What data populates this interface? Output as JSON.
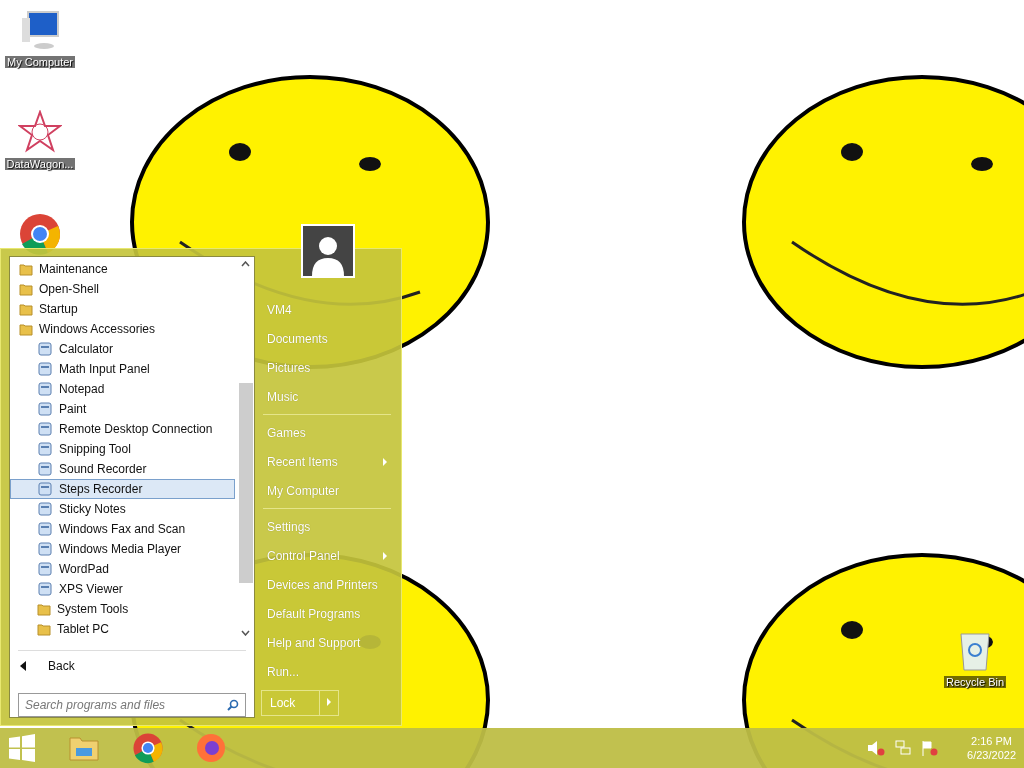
{
  "desktop_icons": [
    {
      "label": "My Computer",
      "kind": "computer"
    },
    {
      "label": "DataWagon...",
      "kind": "star"
    },
    {
      "kind": "chrome"
    }
  ],
  "recycle_bin": {
    "label": "Recycle Bin"
  },
  "start_menu": {
    "programs": [
      {
        "label": "Maintenance",
        "kind": "folder",
        "selected": false
      },
      {
        "label": "Open-Shell",
        "kind": "folder",
        "selected": false
      },
      {
        "label": "Startup",
        "kind": "folder",
        "selected": false
      },
      {
        "label": "Windows Accessories",
        "kind": "folder",
        "selected": false,
        "children": [
          {
            "label": "Calculator",
            "kind": "app",
            "selected": false
          },
          {
            "label": "Math Input Panel",
            "kind": "app",
            "selected": false
          },
          {
            "label": "Notepad",
            "kind": "app",
            "selected": false
          },
          {
            "label": "Paint",
            "kind": "app",
            "selected": false
          },
          {
            "label": "Remote Desktop Connection",
            "kind": "app",
            "selected": false
          },
          {
            "label": "Snipping Tool",
            "kind": "app",
            "selected": false
          },
          {
            "label": "Sound Recorder",
            "kind": "app",
            "selected": false
          },
          {
            "label": "Steps Recorder",
            "kind": "app",
            "selected": true
          },
          {
            "label": "Sticky Notes",
            "kind": "app",
            "selected": false
          },
          {
            "label": "Windows Fax and Scan",
            "kind": "app",
            "selected": false
          },
          {
            "label": "Windows Media Player",
            "kind": "app",
            "selected": false
          },
          {
            "label": "WordPad",
            "kind": "app",
            "selected": false
          },
          {
            "label": "XPS Viewer",
            "kind": "app",
            "selected": false
          },
          {
            "label": "System Tools",
            "kind": "folder",
            "selected": false
          },
          {
            "label": "Tablet PC",
            "kind": "folder",
            "selected": false
          }
        ]
      }
    ],
    "back": "Back",
    "search": {
      "placeholder": "Search programs and files"
    },
    "right_groups": [
      [
        {
          "label": "VM4",
          "submenu": false
        },
        {
          "label": "Documents",
          "submenu": false
        },
        {
          "label": "Pictures",
          "submenu": false
        },
        {
          "label": "Music",
          "submenu": false
        }
      ],
      [
        {
          "label": "Games",
          "submenu": false
        },
        {
          "label": "Recent Items",
          "submenu": true
        },
        {
          "label": "My Computer",
          "submenu": false
        }
      ],
      [
        {
          "label": "Settings",
          "submenu": false
        },
        {
          "label": "Control Panel",
          "submenu": true
        },
        {
          "label": "Devices and Printers",
          "submenu": false
        },
        {
          "label": "Default Programs",
          "submenu": false
        },
        {
          "label": "Help and Support",
          "submenu": false
        },
        {
          "label": "Run...",
          "submenu": false
        }
      ]
    ],
    "lock": "Lock"
  },
  "taskbar": {
    "time": "2:16 PM",
    "date": "6/23/2022"
  }
}
